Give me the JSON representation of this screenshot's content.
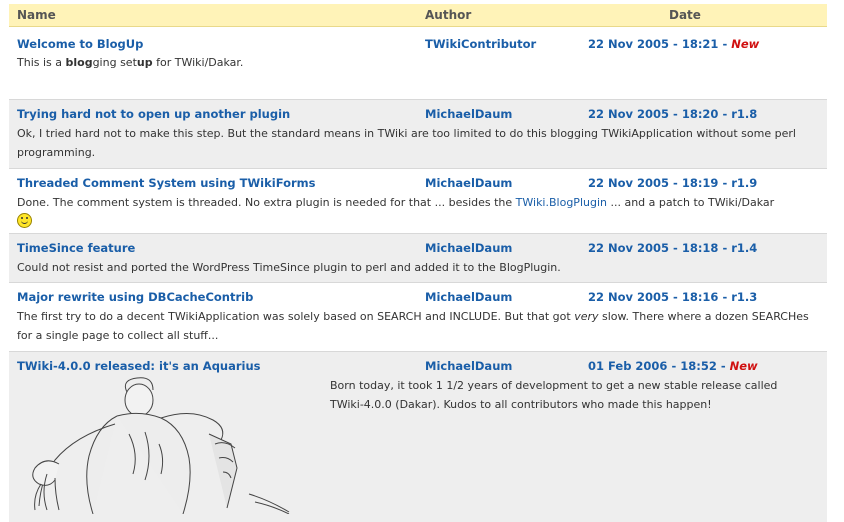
{
  "columns": {
    "name": "Name",
    "author": "Author",
    "date": "Date"
  },
  "rows": [
    {
      "title": "Welcome to BlogUp",
      "author": "TWikiContributor",
      "date": "22 Nov 2005 - 18:21",
      "sep": " - ",
      "status": "New",
      "summary_parts": [
        "This is a ",
        "blog",
        "ging set",
        "up",
        " for TWiki/Dakar."
      ]
    },
    {
      "title": "Trying hard not to open up another plugin",
      "author": "MichaelDaum",
      "date": "22 Nov 2005 - 18:20",
      "sep": " - ",
      "status": "r1.8",
      "summary": "Ok, I tried hard not to make this step. But the standard means in TWiki are too limited to do this blogging TWikiApplication without some perl programming."
    },
    {
      "title": "Threaded Comment System using TWikiForms",
      "author": "MichaelDaum",
      "date": "22 Nov 2005 - 18:19",
      "sep": " - ",
      "status": "r1.9",
      "summary_before": "Done. The comment system is threaded. No extra plugin is needed for that ... besides the ",
      "summary_link": "TWiki.BlogPlugin",
      "summary_after": " ... and a patch to TWiki/Dakar"
    },
    {
      "title": "TimeSince feature",
      "author": "MichaelDaum",
      "date": "22 Nov 2005 - 18:18",
      "sep": " - ",
      "status": "r1.4",
      "summary": "Could not resist and ported the WordPress TimeSince plugin to perl and added it to the BlogPlugin."
    },
    {
      "title": "Major rewrite using DBCacheContrib",
      "author": "MichaelDaum",
      "date": "22 Nov 2005 - 18:16",
      "sep": " - ",
      "status": "r1.3",
      "summary_before": "The first try to do a decent TWikiApplication was solely based on SEARCH and INCLUDE. But that got ",
      "summary_em": "very",
      "summary_after": " slow. There where a dozen SEARCHes for a single page to collect all stuff..."
    },
    {
      "title": "TWiki-4.0.0 released: it's an Aquarius",
      "author": "MichaelDaum",
      "date": "01 Feb 2006 - 18:52",
      "sep": " - ",
      "status": "New",
      "summary": "Born today, it took 1 1/2 years of development to get a new stable release called TWiki-4.0.0 (Dakar). Kudos to all contributors who made this happen!"
    }
  ],
  "icons": {
    "smiley": "smiley-icon",
    "aquarius": "aquarius-illustration"
  },
  "colors": {
    "header_bg": "#fff3b8",
    "link": "#1a5ea8",
    "new": "#d01010",
    "alt_row": "#eeeeee"
  }
}
